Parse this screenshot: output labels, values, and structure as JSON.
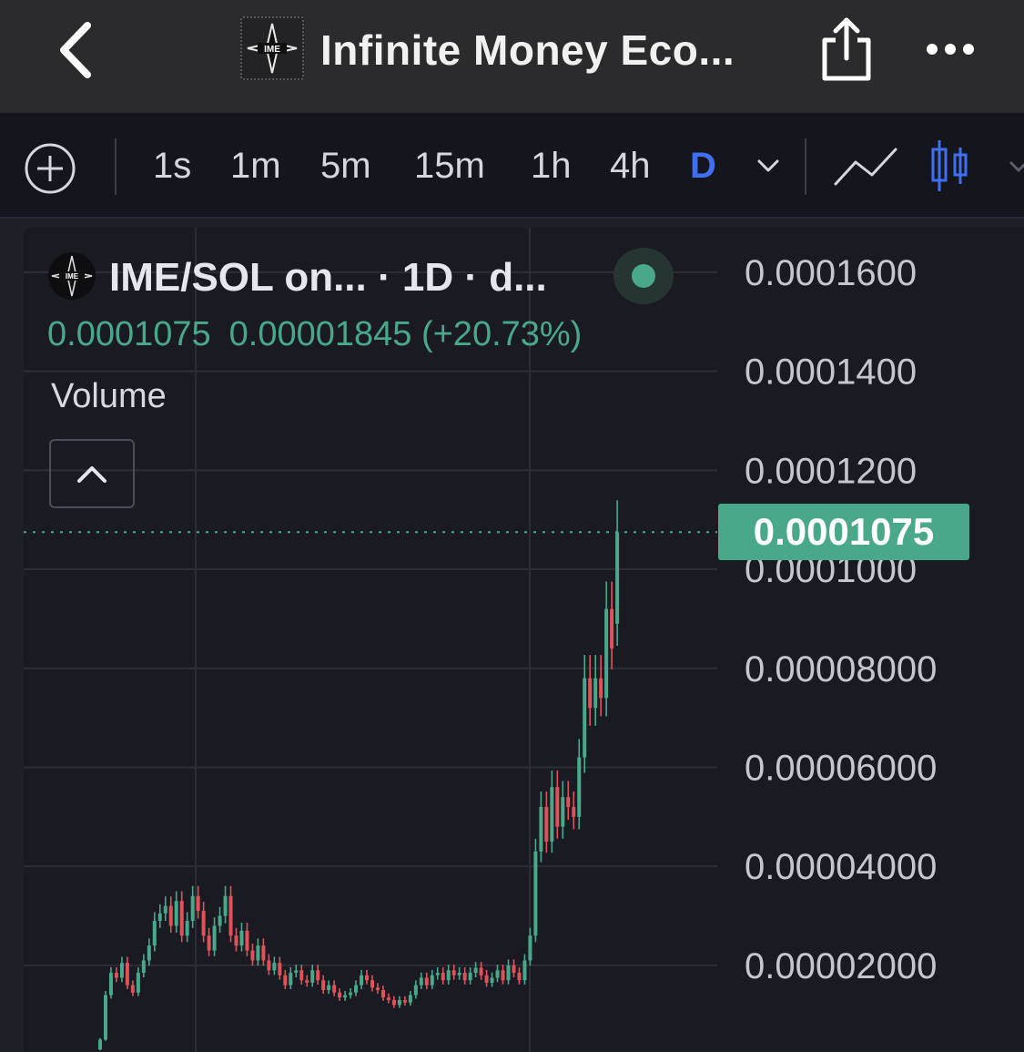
{
  "header": {
    "title": "Infinite Money Eco...",
    "logo_text": "IME"
  },
  "toolbar": {
    "timeframes": [
      "1s",
      "1m",
      "5m",
      "15m",
      "1h",
      "4h",
      "D"
    ],
    "active_timeframe": "D"
  },
  "legend": {
    "pair": "IME/SOL on... · 1D · d...",
    "last_price": "0.0001075",
    "change": "0.00001845 (+20.73%)",
    "volume_label": "Volume"
  },
  "colors": {
    "up": "#4aa88a",
    "down": "#e0525a",
    "accent": "#3f6ff2",
    "background": "#1a1b22"
  },
  "chart_data": {
    "type": "line",
    "subtype": "candlestick",
    "title": "",
    "xlabel": "",
    "ylabel": "",
    "ylim": [
      2.5e-06,
      0.000169
    ],
    "y_ticks": [
      "0.0001600",
      "0.0001400",
      "0.0001200",
      "0.0001000",
      "0.00008000",
      "0.00006000",
      "0.00004000",
      "0.00002000"
    ],
    "y_tick_values": [
      0.00016,
      0.00014,
      0.00012,
      0.0001,
      8e-05,
      6e-05,
      4e-05,
      2e-05
    ],
    "current_price": 0.0001075,
    "current_price_label": "0.0001075",
    "grid": true,
    "series": [
      {
        "values": [
          5e-06,
          1.4e-05,
          1.85e-05,
          1.75e-05,
          2.05e-05,
          1.6e-05,
          1.45e-05,
          1.85e-05,
          2.1e-05,
          2.4e-05,
          2.9e-05,
          3.05e-05,
          3.2e-05,
          2.8e-05,
          3.3e-05,
          2.6e-05,
          2.9e-05,
          3.4e-05,
          3.1e-05,
          2.6e-05,
          2.3e-05,
          2.8e-05,
          3e-05,
          3.4e-05,
          2.6e-05,
          2.4e-05,
          2.7e-05,
          2.3e-05,
          2.1e-05,
          2.4e-05,
          2.1e-05,
          1.9e-05,
          2.05e-05,
          1.8e-05,
          1.6e-05,
          1.85e-05,
          1.9e-05,
          1.7e-05,
          1.65e-05,
          1.9e-05,
          1.7e-05,
          1.5e-05,
          1.6e-05,
          1.45e-05,
          1.35e-05,
          1.4e-05,
          1.45e-05,
          1.6e-05,
          1.8e-05,
          1.7e-05,
          1.55e-05,
          1.5e-05,
          1.35e-05,
          1.3e-05,
          1.2e-05,
          1.3e-05,
          1.25e-05,
          1.4e-05,
          1.6e-05,
          1.75e-05,
          1.6e-05,
          1.8e-05,
          1.85e-05,
          1.7e-05,
          1.9e-05,
          1.8e-05,
          1.85e-05,
          1.7e-05,
          1.85e-05,
          1.95e-05,
          1.8e-05,
          1.65e-05,
          1.75e-05,
          1.9e-05,
          1.7e-05,
          2e-05,
          1.85e-05,
          1.7e-05,
          2.1e-05,
          2.6e-05,
          4.3e-05,
          5.2e-05,
          4.5e-05,
          5.6e-05,
          4.8e-05,
          5.4e-05,
          5.2e-05,
          5e-05,
          6.2e-05,
          7.8e-05,
          7.2e-05,
          7.8e-05,
          7.4e-05,
          9.2e-05,
          8.4e-05,
          0.0001075
        ],
        "opens": [
          3e-06,
          5e-06,
          1.4e-05,
          1.85e-05,
          1.75e-05,
          2.05e-05,
          1.6e-05,
          1.45e-05,
          1.85e-05,
          2.1e-05,
          2.4e-05,
          2.9e-05,
          3.05e-05,
          3.2e-05,
          2.8e-05,
          3.3e-05,
          2.6e-05,
          2.9e-05,
          3.4e-05,
          3.1e-05,
          2.6e-05,
          2.3e-05,
          2.8e-05,
          3e-05,
          3.4e-05,
          2.6e-05,
          2.4e-05,
          2.7e-05,
          2.3e-05,
          2.1e-05,
          2.4e-05,
          2.1e-05,
          1.9e-05,
          2.05e-05,
          1.8e-05,
          1.6e-05,
          1.85e-05,
          1.9e-05,
          1.7e-05,
          1.65e-05,
          1.9e-05,
          1.7e-05,
          1.5e-05,
          1.6e-05,
          1.45e-05,
          1.35e-05,
          1.4e-05,
          1.45e-05,
          1.6e-05,
          1.8e-05,
          1.7e-05,
          1.55e-05,
          1.5e-05,
          1.35e-05,
          1.3e-05,
          1.2e-05,
          1.3e-05,
          1.25e-05,
          1.4e-05,
          1.6e-05,
          1.75e-05,
          1.6e-05,
          1.8e-05,
          1.85e-05,
          1.7e-05,
          1.9e-05,
          1.8e-05,
          1.85e-05,
          1.7e-05,
          1.85e-05,
          1.95e-05,
          1.8e-05,
          1.65e-05,
          1.75e-05,
          1.9e-05,
          1.7e-05,
          2e-05,
          1.85e-05,
          1.7e-05,
          2.1e-05,
          2.6e-05,
          4.3e-05,
          5.2e-05,
          4.5e-05,
          5.6e-05,
          4.8e-05,
          5.4e-05,
          5.2e-05,
          5e-05,
          6.2e-05,
          7.8e-05,
          7.2e-05,
          7.8e-05,
          7.4e-05,
          9.2e-05,
          8.9e-05
        ]
      }
    ]
  }
}
